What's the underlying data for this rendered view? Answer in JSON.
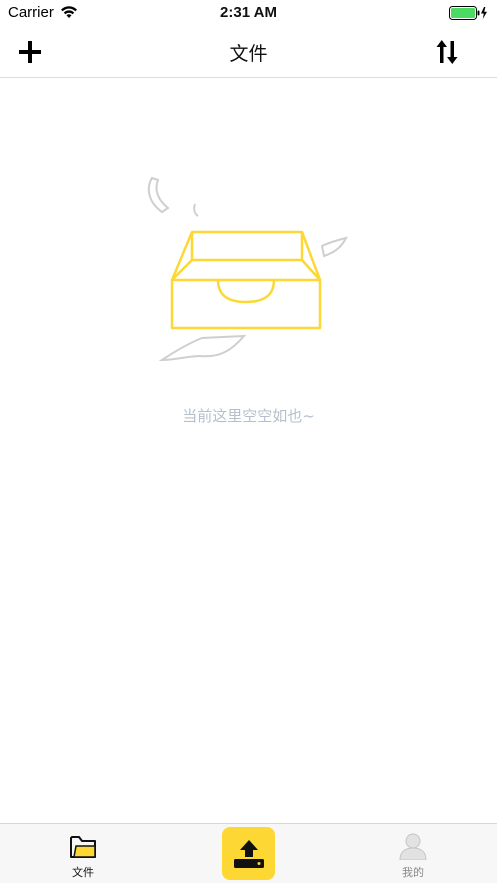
{
  "status_bar": {
    "carrier": "Carrier",
    "time": "2:31 AM",
    "battery_color": "#4cd964"
  },
  "nav": {
    "title": "文件",
    "add_icon": "plus-icon",
    "sort_icon": "sort-icon"
  },
  "empty_state": {
    "message": "当前这里空空如也~",
    "illustration": "empty-tray-illustration",
    "accent_color": "#fdd835"
  },
  "tab_bar": {
    "tabs": [
      {
        "label": "文件",
        "icon": "folder-icon",
        "active": true
      },
      {
        "label": "",
        "icon": "upload-icon",
        "active": false
      },
      {
        "label": "我的",
        "icon": "person-icon",
        "active": false
      }
    ]
  }
}
